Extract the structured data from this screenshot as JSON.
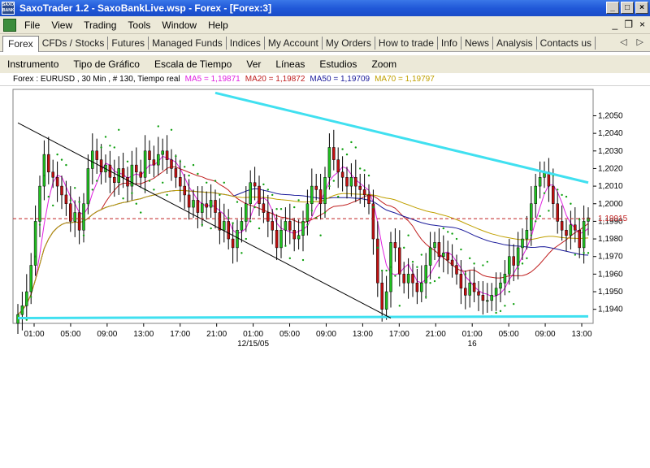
{
  "window": {
    "title": "SaxoTrader 1.2 - SaxoBankLive.wsp - Forex - [Forex:3]",
    "logo_text": "SAXO BANK",
    "btn_min": "_",
    "btn_max": "□",
    "btn_close": "×"
  },
  "menu": {
    "items": [
      "File",
      "View",
      "Trading",
      "Tools",
      "Window",
      "Help"
    ],
    "right_min": "_",
    "right_restore": "❐",
    "right_close": "×"
  },
  "tabs": [
    "Forex",
    "CFDs / Stocks",
    "Futures",
    "Managed Funds",
    "Indices",
    "My Account",
    "My Orders",
    "How to trade",
    "Info",
    "News",
    "Analysis",
    "Contacts us"
  ],
  "tab_arrows": {
    "left": "◁",
    "right": "▷"
  },
  "toolbar": [
    "Instrumento",
    "Tipo de Gráfico",
    "Escala de Tiempo",
    "Ver",
    "Líneas",
    "Estudios",
    "Zoom"
  ],
  "info": {
    "instrument": "Forex : EURUSD , 30 Min , # 130, Tiempo real",
    "ma5": "MA5 = 1,19871",
    "ma20": "MA20 = 1,19872",
    "ma50": "MA50 = 1,19709",
    "ma70": "MA70 = 1,19797",
    "colors": {
      "ma5": "#e020e0",
      "ma20": "#c02020",
      "ma50": "#1a1a9a",
      "ma70": "#c0a000"
    }
  },
  "chart_data": {
    "type": "line",
    "instrument": "EURUSD",
    "ylim": [
      1.1932,
      1.2065
    ],
    "yticks": [
      "1,2050",
      "1,2040",
      "1,2030",
      "1,2020",
      "1,2010",
      "1,2000",
      "1,1990",
      "1,1980",
      "1,1970",
      "1,1960",
      "1,1950",
      "1,1940"
    ],
    "ytick_values": [
      1.205,
      1.204,
      1.203,
      1.202,
      1.201,
      1.2,
      1.199,
      1.198,
      1.197,
      1.196,
      1.195,
      1.194
    ],
    "xticks": [
      "01:00",
      "05:00",
      "09:00",
      "13:00",
      "17:00",
      "21:00",
      "01:00",
      "05:00",
      "09:00",
      "13:00",
      "17:00",
      "21:00",
      "01:00",
      "05:00",
      "09:00",
      "13:00"
    ],
    "date_labels": [
      {
        "text": "12/15/05",
        "at_tick": 6
      },
      {
        "text": "16",
        "at_tick": 12
      }
    ],
    "current_price": "1,19915",
    "current_value": 1.19915,
    "n_bars": 130,
    "closes": [
      1.1937,
      1.1942,
      1.195,
      1.1965,
      1.199,
      1.201,
      1.2028,
      1.2018,
      1.2015,
      1.201,
      1.2005,
      1.2,
      1.199,
      1.1995,
      1.1985,
      1.2,
      1.202,
      1.203,
      1.2025,
      1.2018,
      1.2022,
      1.2015,
      1.2012,
      1.202,
      1.2015,
      1.201,
      1.2022,
      1.2018,
      1.2015,
      1.203,
      1.2025,
      1.2022,
      1.2028,
      1.203,
      1.2025,
      1.202,
      1.2015,
      1.201,
      1.2005,
      1.1998,
      1.2002,
      1.1995,
      1.2,
      1.1998,
      1.2002,
      1.1995,
      1.1985,
      1.199,
      1.198,
      1.1975,
      1.1985,
      1.199,
      1.2,
      1.2012,
      1.201,
      1.2,
      1.1995,
      1.199,
      1.1985,
      1.1975,
      1.1985,
      1.199,
      1.1985,
      1.198,
      1.1982,
      1.199,
      1.2,
      1.201,
      1.2008,
      1.2,
      1.2015,
      1.2032,
      1.2025,
      1.2018,
      1.2015,
      1.201,
      1.2015,
      1.201,
      1.2008,
      1.2005,
      1.2,
      1.198,
      1.1955,
      1.194,
      1.195,
      1.1978,
      1.1975,
      1.196,
      1.1955,
      1.196,
      1.1955,
      1.195,
      1.1955,
      1.1965,
      1.1975,
      1.1978,
      1.197,
      1.1972,
      1.1968,
      1.1965,
      1.196,
      1.1952,
      1.1948,
      1.1955,
      1.195,
      1.1948,
      1.1945,
      1.1945,
      1.1948,
      1.1952,
      1.1955,
      1.196,
      1.197,
      1.1965,
      1.1975,
      1.198,
      1.1985,
      1.2,
      1.201,
      1.2015,
      1.2018,
      1.201,
      1.2,
      1.199,
      1.1985,
      1.1982,
      1.1988,
      1.1985,
      1.1975,
      1.199,
      1.1992
    ],
    "series": [
      {
        "name": "MA5",
        "color": "#e020e0",
        "values_ref": "ma5"
      },
      {
        "name": "MA20",
        "color": "#c02020",
        "values_ref": "ma20"
      },
      {
        "name": "MA50",
        "color": "#1a1a9a",
        "values_ref": "ma50"
      },
      {
        "name": "MA70",
        "color": "#c0a000",
        "values_ref": "ma70"
      }
    ],
    "trendlines": [
      {
        "color": "#40e0f0",
        "from": [
          45,
          1.2063
        ],
        "to": [
          130,
          1.2012
        ]
      },
      {
        "color": "#40e0f0",
        "from": [
          0,
          1.1935
        ],
        "to": [
          130,
          1.1936
        ]
      },
      {
        "color": "#000000",
        "from": [
          0,
          1.2046
        ],
        "to": [
          85,
          1.1935
        ]
      }
    ],
    "colors": {
      "up": "#20c020",
      "down": "#c01010",
      "sar": "#10a010",
      "price_line": "#c02020"
    }
  }
}
